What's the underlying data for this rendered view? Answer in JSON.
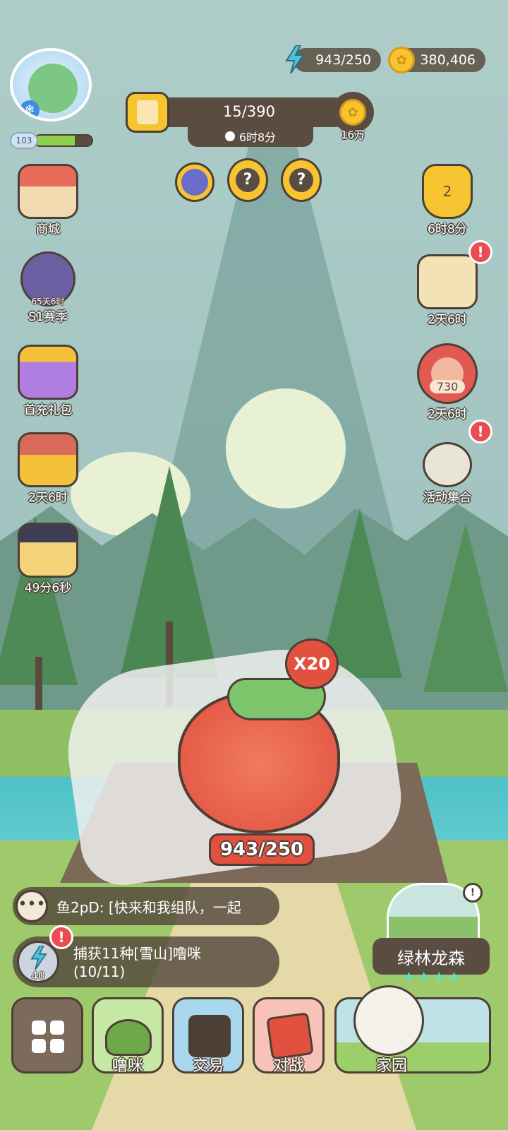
{
  "hud": {
    "energy": "943/250",
    "coins": "380,406",
    "player_level": "103",
    "level_progress": 0.7
  },
  "pass": {
    "progress": "15/390",
    "timer": "6时8分",
    "reward": "16万"
  },
  "left_menu": [
    {
      "label": "商城"
    },
    {
      "label": "S1赛季",
      "sublabel": "65天6时"
    },
    {
      "label": "首充礼包"
    },
    {
      "label": "2天6时"
    },
    {
      "label": "49分6秒"
    }
  ],
  "right_menu": [
    {
      "label": "6时8分",
      "badge": "2"
    },
    {
      "label": "2天6时",
      "alert": "!"
    },
    {
      "label": "2天6时",
      "badge": "730"
    },
    {
      "label": "活动集合",
      "alert": "!"
    }
  ],
  "center_buffs": [
    "?",
    "?"
  ],
  "catch": {
    "multiplier": "X20",
    "count": "943/250"
  },
  "chat": {
    "message": "鱼2pD: [快来和我组队，一起"
  },
  "quest": {
    "energy_cost": "40",
    "title": "捕获11种[雪山]噜咪",
    "progress": "(10/11)",
    "alert": "!"
  },
  "area": {
    "name": "绿林龙森",
    "stars": "✦✦✦✦"
  },
  "bottom_nav": [
    {
      "label": "噜咪"
    },
    {
      "label": "交易"
    },
    {
      "label": "对战"
    },
    {
      "label": "家园"
    }
  ],
  "colors": {
    "accent_red": "#ea4c50",
    "coin_gold": "#f6c430",
    "panel_brown": "#5a4c40",
    "energy_blue": "#4fc1d8"
  }
}
